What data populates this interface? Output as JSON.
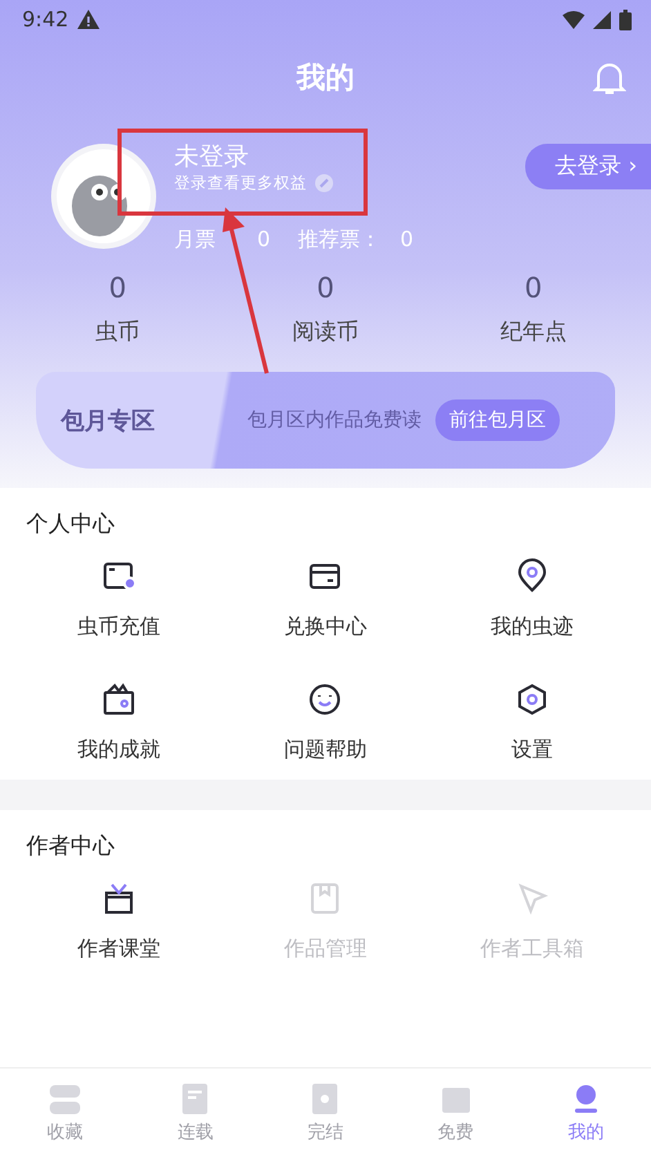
{
  "status_bar": {
    "time": "9:42"
  },
  "header": {
    "title": "我的"
  },
  "profile": {
    "name": "未登录",
    "subtitle": "登录查看更多权益",
    "tickets": [
      {
        "label": "月票",
        "value": "0"
      },
      {
        "label": "推荐票：",
        "value": "0"
      }
    ],
    "login_button": "去登录 ›"
  },
  "stats": [
    {
      "value": "0",
      "label": "虫币"
    },
    {
      "value": "0",
      "label": "阅读币"
    },
    {
      "value": "0",
      "label": "纪年点"
    }
  ],
  "monthly_banner": {
    "title": "包月专区",
    "text": "包月区内作品免费读",
    "button": "前往包月区"
  },
  "sections": [
    {
      "title": "个人中心",
      "items": [
        {
          "label": "虫币充值",
          "disabled": false
        },
        {
          "label": "兑换中心",
          "disabled": false
        },
        {
          "label": "我的虫迹",
          "disabled": false
        },
        {
          "label": "我的成就",
          "disabled": false
        },
        {
          "label": "问题帮助",
          "disabled": false
        },
        {
          "label": "设置",
          "disabled": false
        }
      ]
    },
    {
      "title": "作者中心",
      "items": [
        {
          "label": "作者课堂",
          "disabled": false
        },
        {
          "label": "作品管理",
          "disabled": true
        },
        {
          "label": "作者工具箱",
          "disabled": true
        }
      ]
    }
  ],
  "tab_bar": [
    {
      "label": "收藏",
      "selected": false
    },
    {
      "label": "连载",
      "selected": false
    },
    {
      "label": "完结",
      "selected": false
    },
    {
      "label": "免费",
      "selected": false
    },
    {
      "label": "我的",
      "selected": true
    }
  ]
}
